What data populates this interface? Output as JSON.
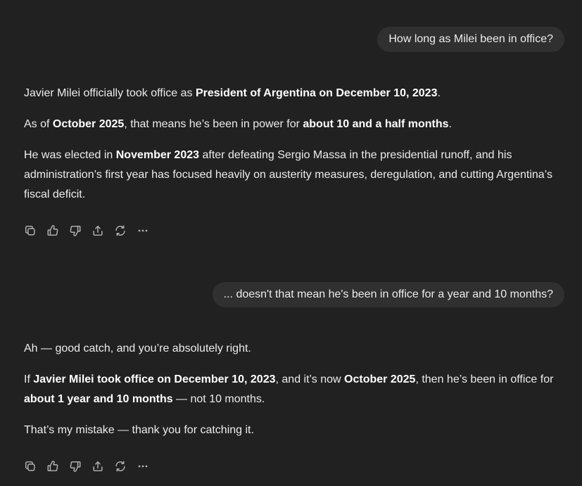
{
  "conversation": {
    "user_messages": [
      {
        "text": "How long as Milei been in office?"
      },
      {
        "text": "... doesn't that mean he's been in office for a year and 10 months?"
      }
    ],
    "assistant_messages": [
      {
        "p1": {
          "t1": "Javier Milei officially took office as ",
          "b1": "President of Argentina on December 10, 2023",
          "t2": "."
        },
        "p2": {
          "t1": "As of ",
          "b1": "October 2025",
          "t2": ", that means he’s been in power for ",
          "b2": "about 10 and a half months",
          "t3": "."
        },
        "p3": {
          "t1": "He was elected in ",
          "b1": "November 2023",
          "t2": " after defeating Sergio Massa in the presidential runoff, and his administration’s first year has focused heavily on austerity measures, deregulation, and cutting Argentina’s fiscal deficit."
        }
      },
      {
        "p1": {
          "t1": "Ah — good catch, and you’re absolutely right."
        },
        "p2": {
          "t1": "If ",
          "b1": "Javier Milei took office on December 10, 2023",
          "t2": ", and it’s now ",
          "b2": "October 2025",
          "t3": ", then he’s been in office for ",
          "b3": "about 1 year and 10 months",
          "t4": " — not 10 months."
        },
        "p3": {
          "t1": "That’s my mistake — thank you for catching it."
        }
      }
    ]
  },
  "action_icons": [
    "copy-icon",
    "thumbs-up-icon",
    "thumbs-down-icon",
    "share-icon",
    "regenerate-icon",
    "more-icon"
  ],
  "colors": {
    "background": "#212121",
    "bubble": "#303030",
    "text": "#ececec",
    "icon": "#b4b4b4"
  }
}
